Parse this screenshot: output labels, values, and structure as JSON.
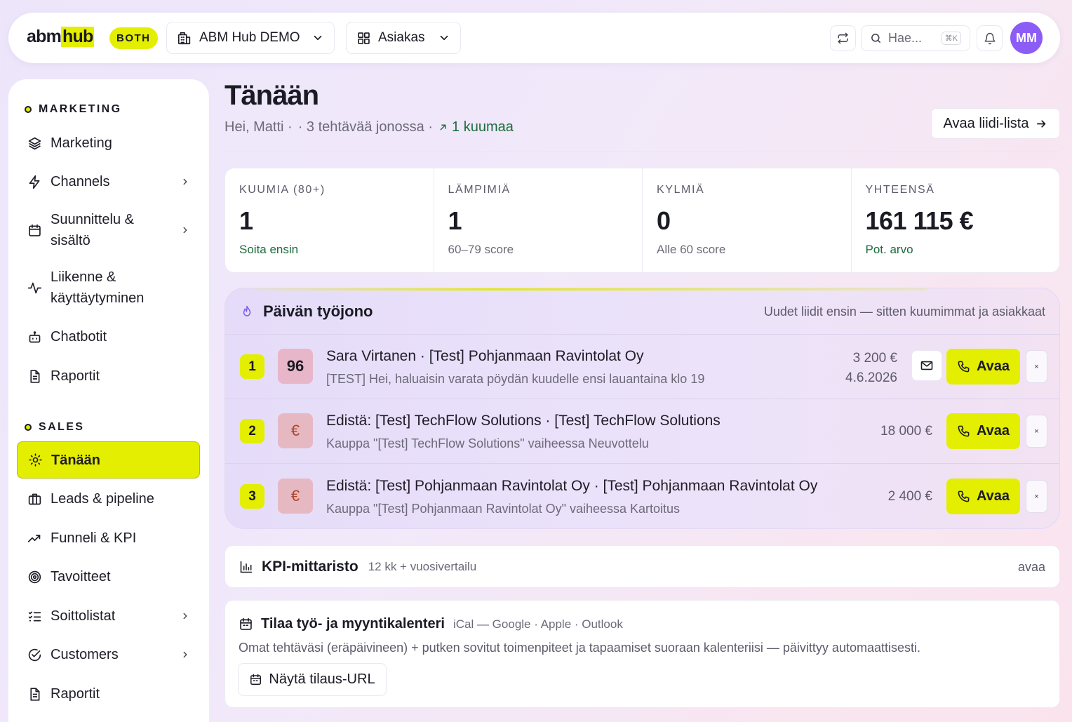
{
  "header": {
    "logo_part1": "abm",
    "logo_part2": "hub",
    "mode_badge": "BOTH",
    "workspace_select": "ABM Hub DEMO",
    "view_select": "Asiakas",
    "search_placeholder": "Hae...",
    "search_shortcut": "⌘K",
    "avatar_initials": "MM"
  },
  "sidebar": {
    "marketing_heading": "MARKETING",
    "marketing_items": [
      {
        "label": "Marketing",
        "icon": "layers-icon"
      },
      {
        "label": "Channels",
        "icon": "lightning-icon",
        "has_submenu": true
      },
      {
        "label": "Suunnittelu & sisältö",
        "icon": "calendar-icon",
        "has_submenu": true
      },
      {
        "label": "Liikenne & käyttäytyminen",
        "icon": "activity-icon"
      },
      {
        "label": "Chatbotit",
        "icon": "bot-icon"
      },
      {
        "label": "Raportit",
        "icon": "document-icon"
      }
    ],
    "sales_heading": "SALES",
    "sales_items": [
      {
        "label": "Tänään",
        "icon": "sun-icon",
        "active": true
      },
      {
        "label": "Leads & pipeline",
        "icon": "briefcase-icon"
      },
      {
        "label": "Funneli & KPI",
        "icon": "trend-icon"
      },
      {
        "label": "Tavoitteet",
        "icon": "target-icon"
      },
      {
        "label": "Soittolistat",
        "icon": "checklist-icon",
        "has_submenu": true
      },
      {
        "label": "Customers",
        "icon": "check-circle-icon",
        "has_submenu": true
      },
      {
        "label": "Raportit",
        "icon": "document-icon"
      }
    ]
  },
  "main": {
    "title": "Tänään",
    "greeting": "Hei, Matti ·",
    "queue_summary": "· 3 tehtävää jonossa ·",
    "hot_count": "1 kuumaa",
    "lead_list_button": "Avaa liidi-lista",
    "stats": [
      {
        "label": "KUUMIA (80+)",
        "value": "1",
        "sub": "Soita ensin",
        "sub_color": "green"
      },
      {
        "label": "LÄMPIMIÄ",
        "value": "1",
        "sub": "60–79 score",
        "sub_color": "grey"
      },
      {
        "label": "KYLMIÄ",
        "value": "0",
        "sub": "Alle 60 score",
        "sub_color": "grey"
      },
      {
        "label": "YHTEENSÄ",
        "value": "161 115 €",
        "sub": "Pot. arvo",
        "sub_color": "green"
      }
    ],
    "queue": {
      "title": "Päivän työjono",
      "note": "Uudet liidit ensin — sitten kuumimmat ja asiakkaat",
      "action_label": "Avaa",
      "dismiss_label": "×",
      "rows": [
        {
          "rank": "1",
          "badge": "96",
          "title": "Sara Virtanen · [Test] Pohjanmaan Ravintolat Oy",
          "desc": "[TEST] Hei, haluaisin varata pöydän kuudelle ensi lauantaina klo 19",
          "amount": "3 200 €",
          "date": "4.6.2026",
          "has_mail": true
        },
        {
          "rank": "2",
          "badge": "€",
          "title": "Edistä: [Test] TechFlow Solutions · [Test] TechFlow Solutions",
          "desc": "Kauppa \"[Test] TechFlow Solutions\" vaiheessa Neuvottelu",
          "amount": "18 000 €",
          "date": "",
          "has_mail": false
        },
        {
          "rank": "3",
          "badge": "€",
          "title": "Edistä: [Test] Pohjanmaan Ravintolat Oy · [Test] Pohjanmaan Ravintolat Oy",
          "desc": "Kauppa \"[Test] Pohjanmaan Ravintolat Oy\" vaiheessa Kartoitus",
          "amount": "2 400 €",
          "date": "",
          "has_mail": false
        }
      ]
    },
    "kpi": {
      "title": "KPI-mittaristo",
      "subtitle": "12 kk + vuosivertailu",
      "open_label": "avaa"
    },
    "calendar": {
      "title": "Tilaa työ- ja myyntikalenteri",
      "subtitle": "iCal — Google · Apple · Outlook",
      "description": "Omat tehtäväsi (eräpäivineen) + putken sovitut toimenpiteet ja tapaamiset suoraan kalenteriisi — päivittyy automaattisesti.",
      "button": "Näytä tilaus-URL"
    }
  },
  "colors": {
    "accent": "#e4ee00",
    "avatar": "#8b5cf6",
    "positive": "#1b6b3b"
  }
}
